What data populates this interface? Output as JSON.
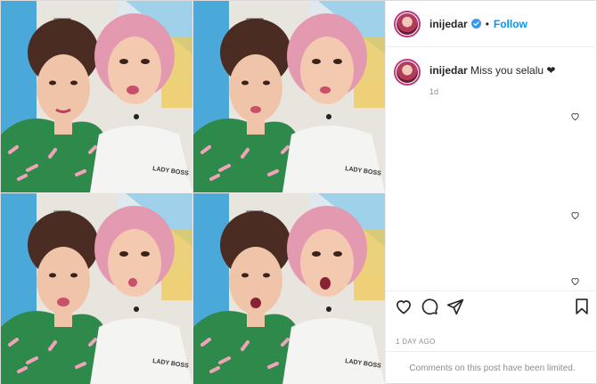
{
  "post": {
    "username": "inijedar",
    "follow_label": "Follow",
    "separator": "•",
    "caption": "Miss you selalu ❤",
    "caption_age": "1d",
    "date": "1 DAY AGO",
    "comments_limited": "Comments on this post have been limited.",
    "shirt_text": "LADY BOSS"
  },
  "colors": {
    "accent": "#0095f6",
    "verified": "#3897f0",
    "muted": "#8e8e8e",
    "border": "#dbdbdb",
    "wall_blue": "#4aa9d8",
    "dress_green": "#2e8a4a",
    "hair_pink": "#e39ab0"
  },
  "icons": {
    "like": "heart-icon",
    "comment": "comment-icon",
    "share": "paper-plane-icon",
    "save": "bookmark-icon",
    "verified": "verified-badge-icon"
  }
}
